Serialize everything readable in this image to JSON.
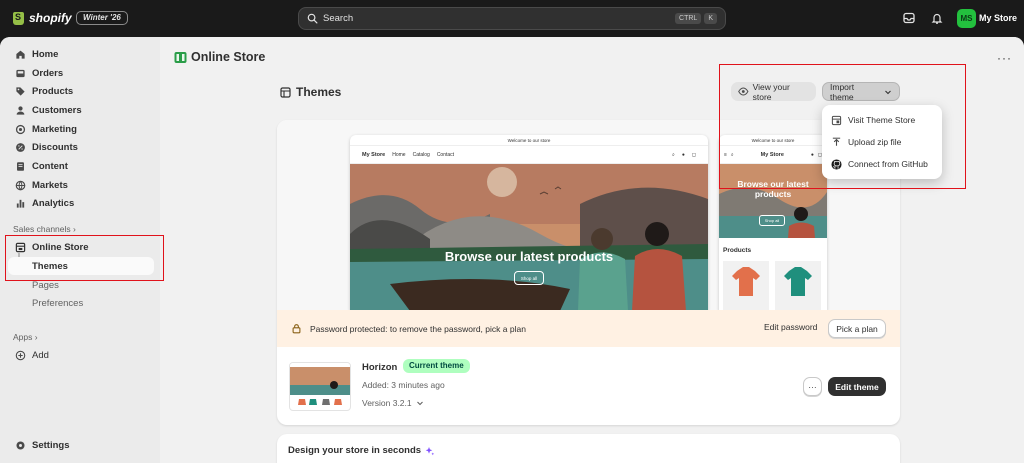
{
  "topbar": {
    "brand": "shopify",
    "edition": "Winter '26",
    "search_placeholder": "Search",
    "shortcut_keys": [
      "CTRL",
      "K"
    ],
    "avatar_initials": "MS",
    "store_name": "My Store"
  },
  "sidebar": {
    "items": [
      {
        "label": "Home",
        "icon": "home-icon"
      },
      {
        "label": "Orders",
        "icon": "inbox-icon"
      },
      {
        "label": "Products",
        "icon": "tag-icon"
      },
      {
        "label": "Customers",
        "icon": "person-icon"
      },
      {
        "label": "Marketing",
        "icon": "target-icon"
      },
      {
        "label": "Discounts",
        "icon": "discount-icon"
      },
      {
        "label": "Content",
        "icon": "document-icon"
      },
      {
        "label": "Markets",
        "icon": "globe-icon"
      },
      {
        "label": "Analytics",
        "icon": "bar-chart-icon"
      }
    ],
    "sales_channels_label": "Sales channels",
    "online_store_label": "Online Store",
    "sub_items": [
      {
        "label": "Themes"
      },
      {
        "label": "Pages"
      },
      {
        "label": "Preferences"
      }
    ],
    "apps_label": "Apps",
    "add_label": "Add",
    "settings_label": "Settings"
  },
  "page": {
    "title": "Online Store",
    "section_title": "Themes",
    "view_store_label": "View your store",
    "import_theme_label": "Import theme"
  },
  "import_menu": {
    "items": [
      {
        "label": "Visit Theme Store",
        "icon": "store-icon"
      },
      {
        "label": "Upload zip file",
        "icon": "upload-icon"
      },
      {
        "label": "Connect from GitHub",
        "icon": "github-icon"
      }
    ]
  },
  "preview": {
    "announcement": "Welcome to our store",
    "store_name": "My Store",
    "nav": [
      "Home",
      "Catalog",
      "Contact"
    ],
    "hero_heading": "Browse our latest products",
    "hero_button": "Shop all",
    "mobile_hero_heading": "Browse our latest products",
    "mobile_section": "Products"
  },
  "banner": {
    "text": "Password protected: to remove the password, pick a plan",
    "edit_password_label": "Edit password",
    "pick_plan_label": "Pick a plan"
  },
  "current_theme": {
    "name": "Horizon",
    "badge": "Current theme",
    "added": "Added: 3 minutes ago",
    "version": "Version 3.2.1",
    "edit_label": "Edit theme",
    "more_label": "···"
  },
  "design_card": {
    "title": "Design your store in seconds"
  },
  "colors": {
    "accent_green": "#23c13e",
    "badge_green": "#affebf",
    "banner_bg": "#fff1e3",
    "annotation_red": "#e0121b"
  }
}
